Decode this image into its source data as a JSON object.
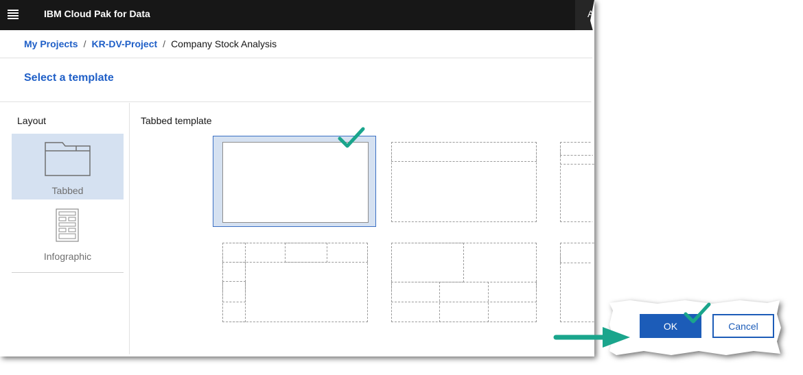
{
  "topbar": {
    "app_title": "IBM Cloud Pak for Data",
    "user_initial": "A"
  },
  "breadcrumb": {
    "items": [
      "My Projects",
      "KR-DV-Project"
    ],
    "current": "Company Stock Analysis",
    "separator": "/"
  },
  "page": {
    "title": "Select a template"
  },
  "sidebar": {
    "heading": "Layout",
    "items": [
      {
        "label": "Tabbed",
        "icon": "folder-tab-icon",
        "selected": true
      },
      {
        "label": "Infographic",
        "icon": "infographic-icon",
        "selected": false
      }
    ]
  },
  "main": {
    "section_label": "Tabbed template"
  },
  "dialog": {
    "ok_label": "OK",
    "cancel_label": "Cancel"
  },
  "colors": {
    "accent": "#1f5fc7",
    "selected_bg": "#d5e1f1",
    "check": "#1aa58c",
    "ok_button": "#1c5cb8",
    "topbar": "#171717"
  }
}
